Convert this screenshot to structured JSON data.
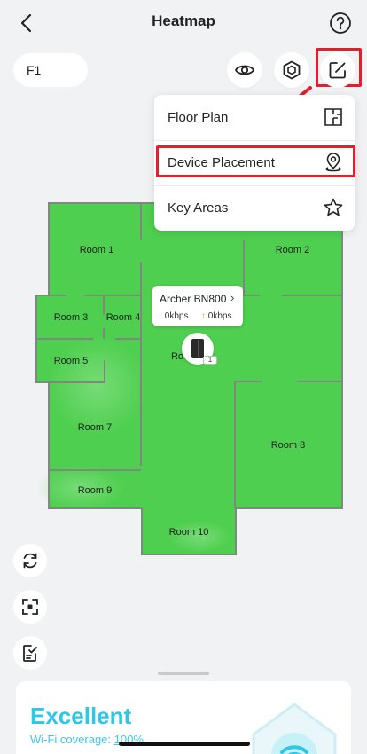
{
  "header": {
    "title": "Heatmap"
  },
  "toolbar": {
    "floor": "F1"
  },
  "menu": {
    "items": [
      {
        "label": "Floor Plan",
        "icon": "floor-plan-icon"
      },
      {
        "label": "Device Placement",
        "icon": "location-pin-icon"
      },
      {
        "label": "Key Areas",
        "icon": "star-icon"
      }
    ]
  },
  "map": {
    "rooms": [
      "Room 1",
      "Room 2",
      "Room 3",
      "Room 4",
      "Room 5",
      "Room 7",
      "Room 8",
      "Room 9",
      "Room 10"
    ],
    "partial_room_label": "Ro"
  },
  "device": {
    "name": "Archer BN800",
    "download": "0kbps",
    "upload": "0kbps",
    "badge": "1"
  },
  "coverage": {
    "title": "Excellent",
    "subtitle_prefix": "Wi-Fi coverage: ",
    "subtitle_value": "100%"
  },
  "colors": {
    "map_green": "#4fcf4f",
    "wall": "#7d8a7d",
    "highlight": "#e0202e",
    "accent": "#2ec8e6"
  }
}
